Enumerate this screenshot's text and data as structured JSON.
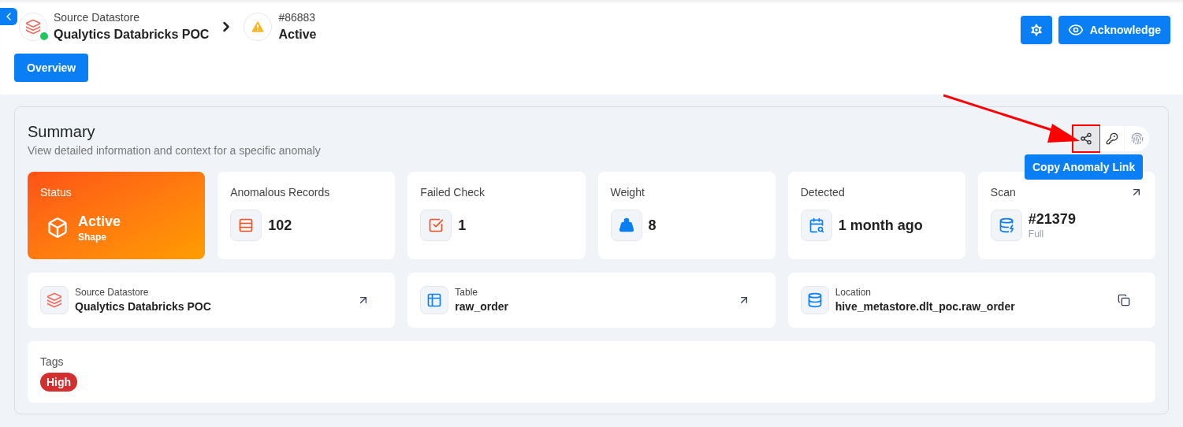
{
  "breadcrumb": {
    "datastore": {
      "label": "Source Datastore",
      "name": "Qualytics Databricks POC",
      "connected": true
    },
    "anomaly": {
      "id": "#86883",
      "status": "Active"
    }
  },
  "header_actions": {
    "acknowledge": "Acknowledge"
  },
  "tabs": [
    {
      "label": "Overview",
      "selected": true
    }
  ],
  "summary": {
    "title": "Summary",
    "subtitle": "View detailed information and context for a specific anomaly",
    "actions": [
      {
        "kind": "share",
        "selected": true
      },
      {
        "kind": "key",
        "selected": false
      },
      {
        "kind": "fingerprint",
        "selected": false
      }
    ],
    "tooltip": "Copy Anomaly Link",
    "stats": [
      {
        "kind": "status",
        "label": "Status",
        "value": "Active",
        "sub": "Shape"
      },
      {
        "kind": "metric",
        "label": "Anomalous Records",
        "value": "102"
      },
      {
        "kind": "metric",
        "label": "Failed Check",
        "value": "1"
      },
      {
        "kind": "metric",
        "label": "Weight",
        "value": "8"
      },
      {
        "kind": "metric",
        "label": "Detected",
        "value": "1 month ago"
      },
      {
        "kind": "link",
        "label": "Scan",
        "value": "#21379",
        "sub": "Full"
      }
    ],
    "details": [
      {
        "kind": "link",
        "label": "Source Datastore",
        "value": "Qualytics Databricks POC"
      },
      {
        "kind": "link",
        "label": "Table",
        "value": "raw_order"
      },
      {
        "kind": "copy",
        "label": "Location",
        "value": "hive_metastore.dlt_poc.raw_order"
      }
    ],
    "tags": {
      "label": "Tags",
      "items": [
        {
          "label": "High",
          "color": "#d32f2f"
        }
      ]
    }
  }
}
